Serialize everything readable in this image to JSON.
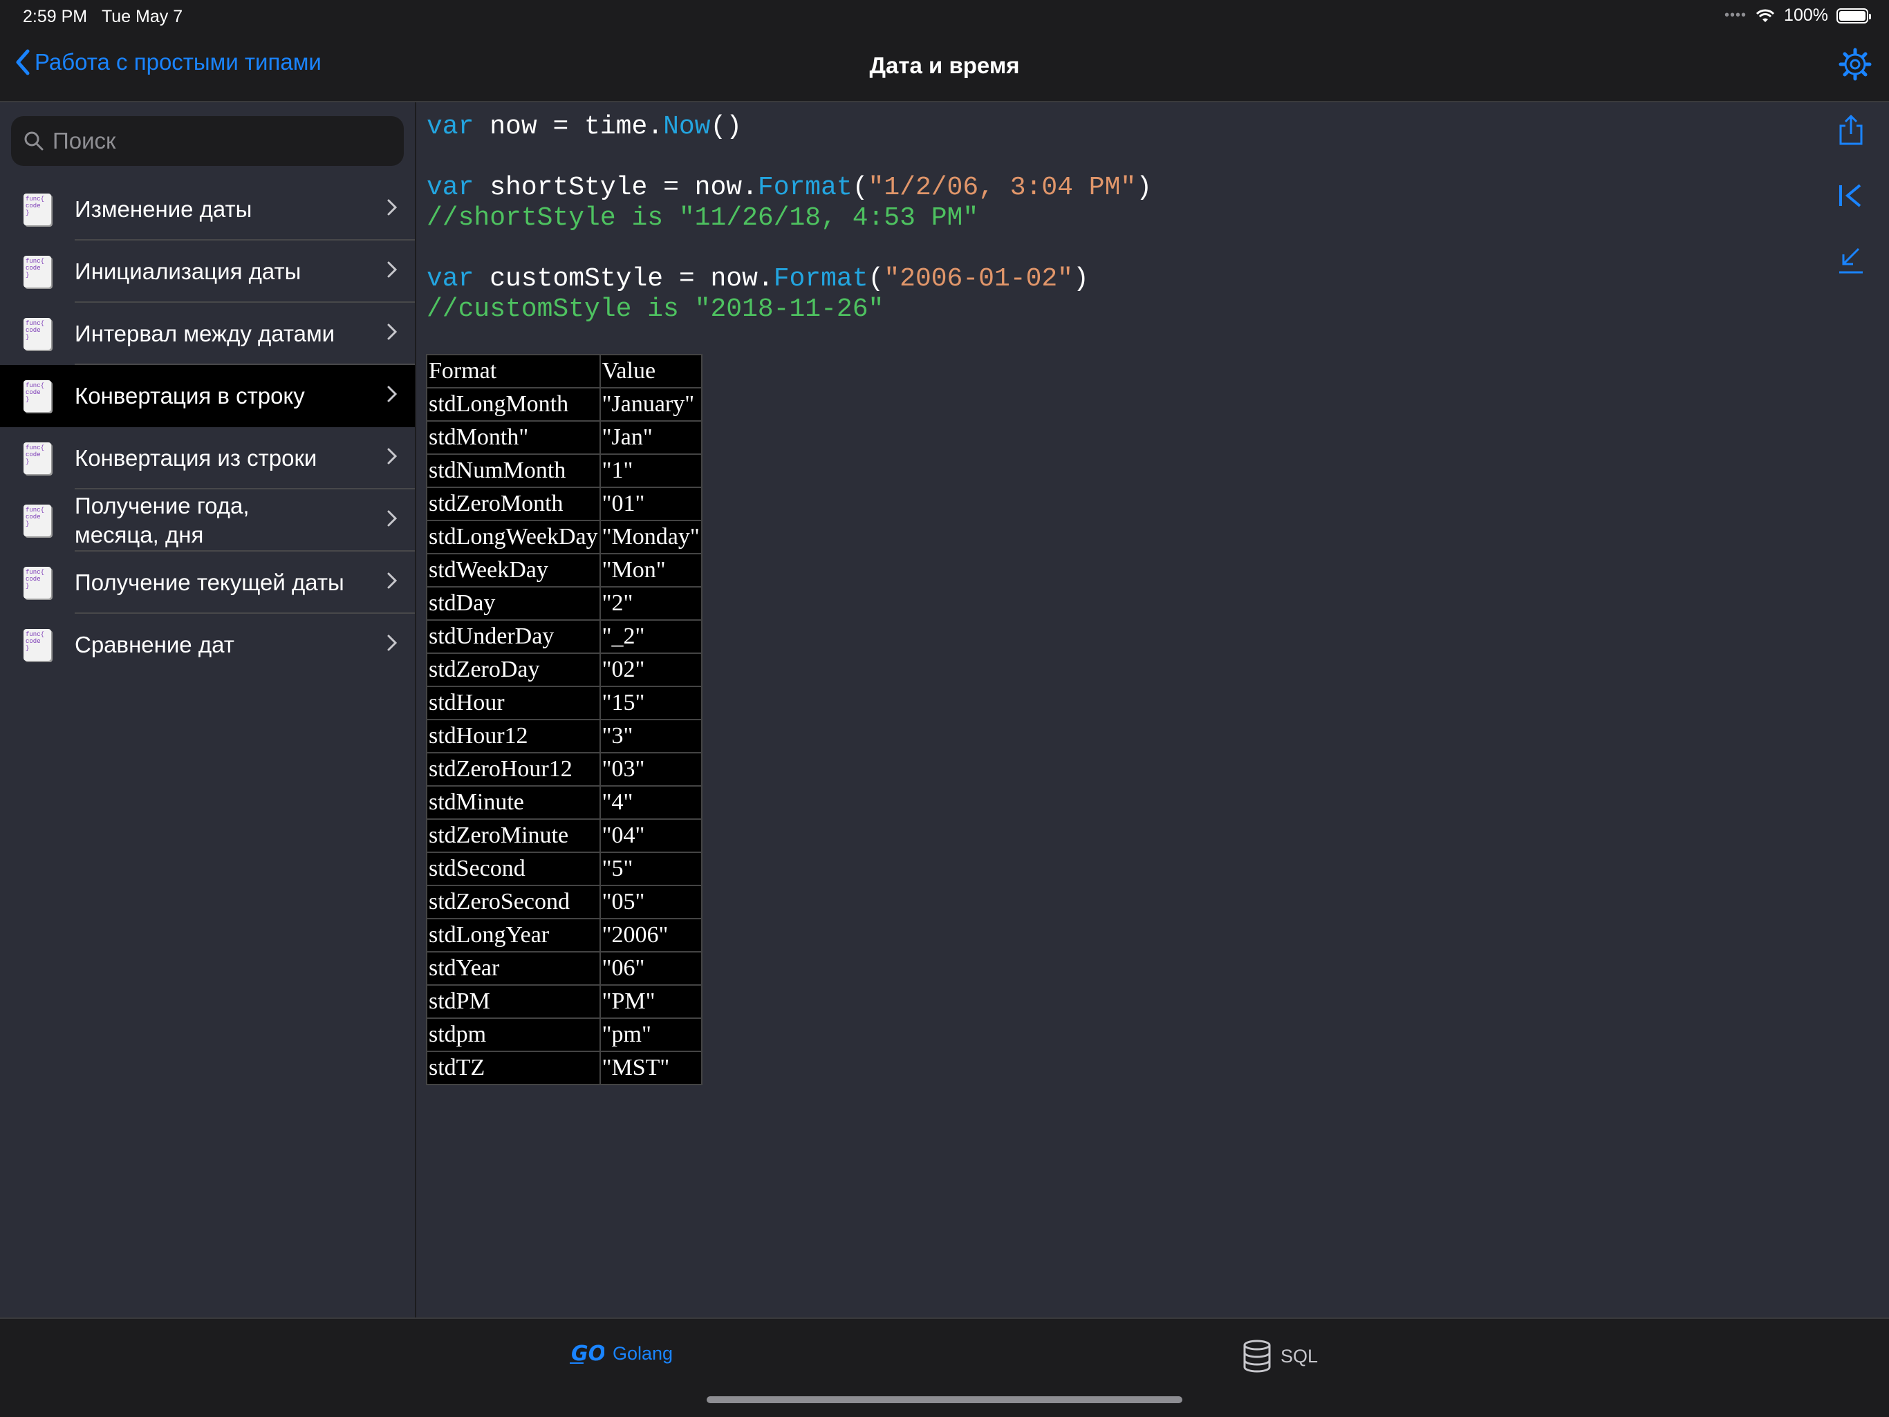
{
  "status_bar": {
    "time": "2:59 PM",
    "date": "Tue May 7",
    "battery": "100%"
  },
  "nav": {
    "back_label": "Работа с простыми типами",
    "title": "Дата и время"
  },
  "search": {
    "placeholder": "Поиск"
  },
  "sidebar": {
    "items": [
      {
        "label": "Изменение даты",
        "active": false
      },
      {
        "label": "Инициализация даты",
        "active": false
      },
      {
        "label": "Интервал между датами",
        "active": false
      },
      {
        "label": "Конвертация в строку",
        "active": true
      },
      {
        "label": "Конвертация из строки",
        "active": false
      },
      {
        "label": "Получение года, месяца, дня",
        "active": false
      },
      {
        "label": "Получение текущей даты",
        "active": false
      },
      {
        "label": "Сравнение дат",
        "active": false
      }
    ],
    "icon_text": "func{ code }"
  },
  "code": {
    "line1": {
      "kw": "var",
      "a": " now = time.",
      "fn": "Now",
      "b": "()"
    },
    "line2": {
      "kw": "var",
      "a": " shortStyle = now.",
      "fn": "Format",
      "b": "(",
      "str": "\"1/2/06, 3:04 PM\"",
      "c": ")"
    },
    "line3": {
      "comment": "//shortStyle is \"11/26/18, 4:53 PM\""
    },
    "line4": {
      "kw": "var",
      "a": " customStyle = now.",
      "fn": "Format",
      "b": "(",
      "str": "\"2006-01-02\"",
      "c": ")"
    },
    "line5": {
      "comment": "//customStyle is \"2018-11-26\""
    }
  },
  "table": {
    "headers": [
      "Format",
      "Value"
    ],
    "rows": [
      [
        "stdLongMonth",
        "\"January\""
      ],
      [
        "stdMonth\"",
        "\"Jan\""
      ],
      [
        "stdNumMonth",
        "\"1\""
      ],
      [
        "stdZeroMonth",
        "\"01\""
      ],
      [
        "stdLongWeekDay",
        "\"Monday\""
      ],
      [
        "stdWeekDay",
        "\"Mon\""
      ],
      [
        "stdDay",
        "\"2\""
      ],
      [
        "stdUnderDay",
        "\"_2\""
      ],
      [
        "stdZeroDay",
        "\"02\""
      ],
      [
        "stdHour",
        "\"15\""
      ],
      [
        "stdHour12",
        "\"3\""
      ],
      [
        "stdZeroHour12",
        "\"03\""
      ],
      [
        "stdMinute",
        "\"4\""
      ],
      [
        "stdZeroMinute",
        "\"04\""
      ],
      [
        "stdSecond",
        "\"5\""
      ],
      [
        "stdZeroSecond",
        "\"05\""
      ],
      [
        "stdLongYear",
        "\"2006\""
      ],
      [
        "stdYear",
        "\"06\""
      ],
      [
        "stdPM",
        "\"PM\""
      ],
      [
        "stdpm",
        "\"pm\""
      ],
      [
        "stdTZ",
        "\"MST\""
      ]
    ]
  },
  "tabs": {
    "golang": "Golang",
    "sql": "SQL"
  },
  "colors": {
    "accent": "#1a84ff",
    "keyword": "#23a5e0",
    "string": "#e1966a",
    "comment": "#4ec260",
    "background": "#2c2e38"
  }
}
